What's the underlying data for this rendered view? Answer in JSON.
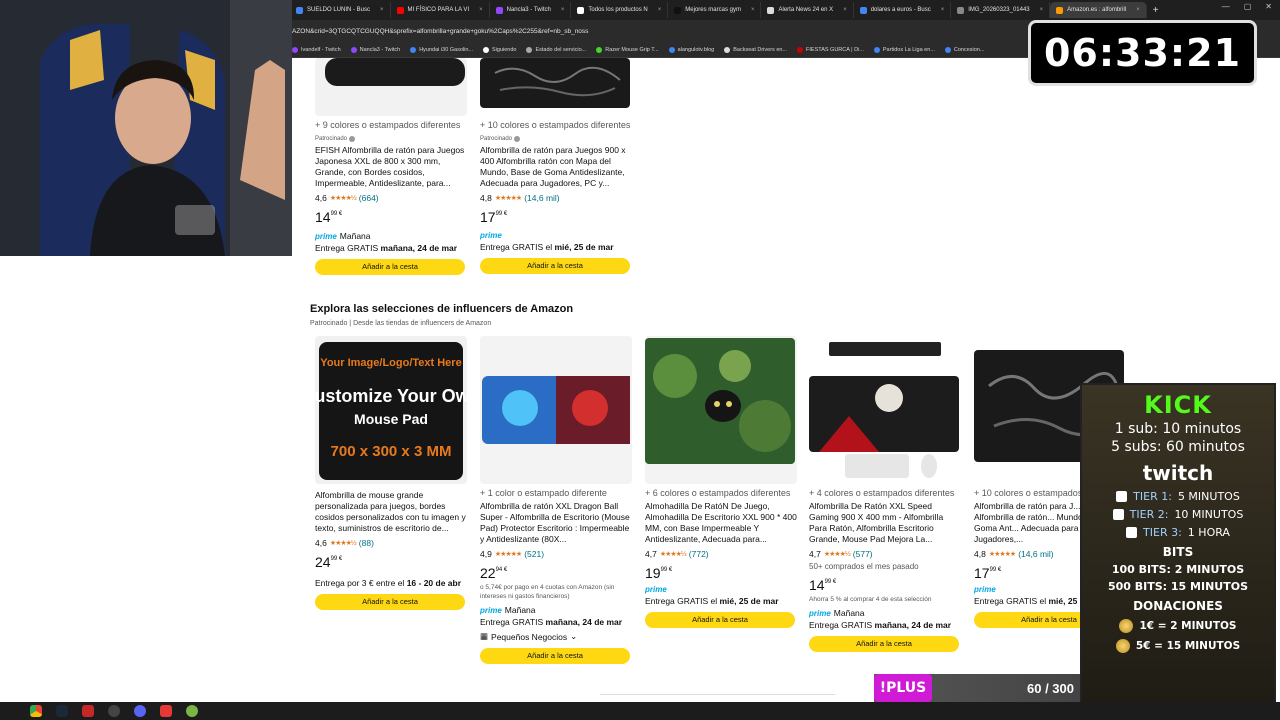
{
  "browser": {
    "tabs": [
      {
        "label": "SUELDO LUNIN - Busc",
        "color": "#4285f4"
      },
      {
        "label": "MI FÍSICO PARA LA VI",
        "color": "#ff0000"
      },
      {
        "label": "Nancla3 - Twitch",
        "color": "#9146ff"
      },
      {
        "label": "Todos los productos N",
        "color": "#ffffff"
      },
      {
        "label": "Mejores marcas gym",
        "color": "#111111"
      },
      {
        "label": "Alerta News 24 en X",
        "color": "#dddddd"
      },
      {
        "label": "dolares a euros - Busc",
        "color": "#4285f4"
      },
      {
        "label": "IMG_20260323_01443",
        "color": "#888888"
      },
      {
        "label": "Amazon.es : alfombrill",
        "color": "#ff9900",
        "active": true
      }
    ],
    "new_tab": "+",
    "url": "AZÕÑ&crid=3QTGCQTCGUQQH&sprefix=alfombrilla+grande+goku%2Caps%2C255&ref=nb_sb_noss",
    "bookmarks": [
      "Ivandelf - Twitch",
      "Nancla3 - Twitch",
      "Hyundai i30 Gasolin...",
      "Siguiendo",
      "Estado del servicio...",
      "Razer Mouse Grip T...",
      "alangulotv.blog",
      "Backseat Drivers en...",
      "FIESTAS GURCA | Di...",
      "Partidos La Liga en...",
      "Concesion..."
    ]
  },
  "top_products": [
    {
      "colors": "+ 9 colores o estampados diferentes",
      "sponsored": "Patrocinado",
      "title": "EFISH Alfombrilla de ratón para Juegos Japonesa XXL de 800 x 300 mm, Grande, con Bordes cosidos, Impermeable, Antideslizante, para...",
      "rating": "4,6",
      "stars": "★★★★½",
      "reviews": "(664)",
      "price_whole": "14",
      "price_frac": "99 €",
      "prime_label": "prime",
      "prime_day": "Mañana",
      "delivery_prefix": "Entrega GRATIS",
      "delivery_date": "mañana, 24 de mar",
      "button": "Añadir a la cesta"
    },
    {
      "colors": "+ 10 colores o estampados diferentes",
      "sponsored": "Patrocinado",
      "title": "Alfombrilla de ratón para Juegos 900 x 400 Alfombrilla ratón con Mapa del Mundo, Base de Goma Antideslizante, Adecuada para Jugadores, PC y...",
      "rating": "4,8",
      "stars": "★★★★★",
      "reviews": "(14,6 mil)",
      "price_whole": "17",
      "price_frac": "99 €",
      "prime_label": "prime",
      "prime_day": "",
      "delivery_prefix": "Entrega GRATIS el",
      "delivery_date": "mié, 25 de mar",
      "button": "Añadir a la cesta"
    }
  ],
  "section": {
    "heading": "Explora las selecciones de influencers de Amazon",
    "subheading": "Patrocinado | Desde las tiendas de influencers de Amazon"
  },
  "products": [
    {
      "image_text": [
        "Your Image/Logo/Text Here",
        "Customize Your Own",
        "Mouse Pad",
        "700 x 300 x 3 MM"
      ],
      "colors": "",
      "title": "Alfombrilla de mouse grande personalizada para juegos, bordes cosidos personalizados con tu imagen y texto, suministros de escritorio de...",
      "rating": "4,6",
      "stars": "★★★★½",
      "reviews": "(88)",
      "price_whole": "24",
      "price_frac": "99 €",
      "extra": "",
      "prime_day": "",
      "delivery_prefix": "Entrega por 3 € entre el",
      "delivery_date": "16 - 20 de abr",
      "button": "Añadir a la cesta"
    },
    {
      "colors": "+ 1 color o estampado diferente",
      "title": "Alfombrilla de ratón XXL Dragon Ball Super - Alfombrilla de Escritorio (Mouse Pad) Protector Escritorio : Impermeable y Antideslizante (80X...",
      "rating": "4,9",
      "stars": "★★★★★",
      "reviews": "(521)",
      "price_whole": "22",
      "price_frac": "94 €",
      "extra": "o 5,74€ por pago en 4 cuotas con Amazon (sin intereses ni gastos financieros)",
      "prime_day": "Mañana",
      "delivery_prefix": "Entrega GRATIS",
      "delivery_date": "mañana, 24 de mar",
      "small_business": "Pequeños Negocios",
      "button": "Añadir a la cesta"
    },
    {
      "colors": "+ 6 colores o estampados diferentes",
      "title": "Almohadilla De RatóN De Juego, Almohadilla De Escritorio XXL 900 * 400 MM, con Base Impermeable Y Antideslizante, Adecuada para...",
      "rating": "4,7",
      "stars": "★★★★½",
      "reviews": "(772)",
      "price_whole": "19",
      "price_frac": "99 €",
      "extra": "",
      "prime_day": "",
      "delivery_prefix": "Entrega GRATIS el",
      "delivery_date": "mié, 25 de mar",
      "button": "Añadir a la cesta"
    },
    {
      "colors": "+ 4 colores o estampados diferentes",
      "title": "Alfombrilla De Ratón XXL Speed Gaming 900 X 400 mm - Alfombrilla Para Ratón, Alfombrilla Escritorio Grande, Mouse Pad Mejora La...",
      "rating": "4,7",
      "stars": "★★★★½",
      "reviews": "(577)",
      "bought": "50+ comprados el mes pasado",
      "price_whole": "14",
      "price_frac": "99 €",
      "extra": "Ahorra 5 % al comprar 4 de esta selección",
      "prime_day": "Mañana",
      "delivery_prefix": "Entrega GRATIS",
      "delivery_date": "mañana, 24 de mar",
      "button": "Añadir a la cesta"
    },
    {
      "colors": "+ 10 colores o estampados",
      "title": "Alfombrilla de ratón para J... x 400 Alfombrilla de ratón... Mundo, Base de Goma Ant... Adecuada para Jugadores,...",
      "rating": "4,8",
      "stars": "★★★★★",
      "reviews": "(14,6 mil)",
      "price_whole": "17",
      "price_frac": "99 €",
      "extra": "",
      "prime_day": "",
      "delivery_prefix": "Entrega GRATIS el",
      "delivery_date": "mié, 25",
      "button": "Añadir a la cesta"
    }
  ],
  "timer": "06:33:21",
  "subathon": {
    "kick_title": "KICK",
    "kick_line1": "1 sub: 10 minutos",
    "kick_line2": "5 subs: 60 minutos",
    "twitch_title": "twitch",
    "tiers": [
      {
        "name": "TIER 1:",
        "value": "5 MINUTOS"
      },
      {
        "name": "TIER 2:",
        "value": "10 MINUTOS"
      },
      {
        "name": "TIER 3:",
        "value": "1 HORA"
      }
    ],
    "bits_title": "BITS",
    "bits": [
      "100 BITS: 2 MINUTOS",
      "500 BITS: 15 MINUTOS"
    ],
    "donations_title": "DONACIONES",
    "donations": [
      "1€ = 2 MINUTOS",
      "5€ = 15 MINUTOS"
    ]
  },
  "plus": {
    "label": "!PLUS",
    "count": "60 / 300"
  },
  "colors": {
    "accent": "#ffd814",
    "kick": "#53fc18",
    "plus": "#d01bd6",
    "prime": "#00a8e1",
    "link": "#007185"
  }
}
